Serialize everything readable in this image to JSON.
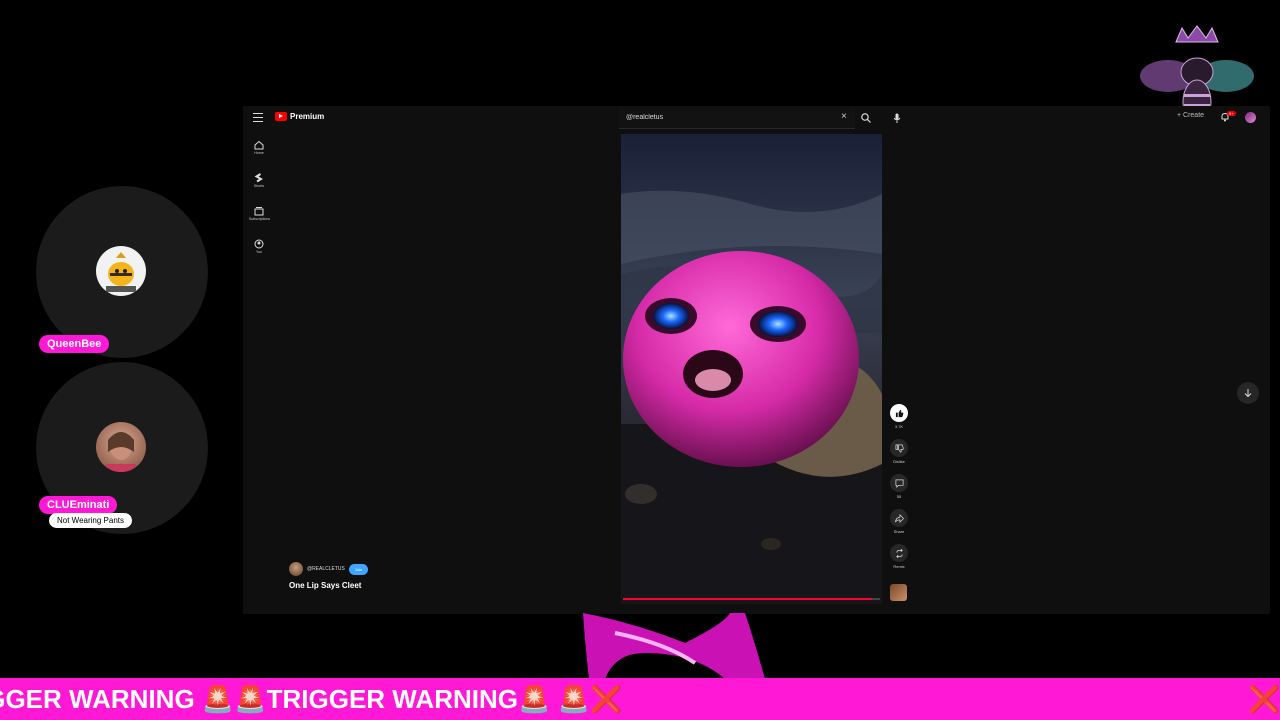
{
  "participants": [
    {
      "name": "QueenBee",
      "status": ""
    },
    {
      "name": "CLUEminati",
      "status": "Not Wearing Pants"
    }
  ],
  "youtube": {
    "brand": "Premium",
    "search": {
      "value": "@realcletus",
      "placeholder": "Search"
    },
    "create_label": "+ Create",
    "notification_count": "9+",
    "nav": [
      {
        "label": "Home",
        "icon": "home-icon"
      },
      {
        "label": "Shorts",
        "icon": "shorts-icon"
      },
      {
        "label": "Subscriptions",
        "icon": "subscriptions-icon"
      },
      {
        "label": "You",
        "icon": "you-icon"
      }
    ],
    "short": {
      "channel": "@REALCLETUS",
      "join_label": "Join",
      "title": "One Lip Says Cleet",
      "progress": 0.97,
      "actions": [
        {
          "label": "3.7K",
          "icon": "like-icon"
        },
        {
          "label": "Dislike",
          "icon": "dislike-icon"
        },
        {
          "label": "55",
          "icon": "comment-icon"
        },
        {
          "label": "Share",
          "icon": "share-icon"
        },
        {
          "label": "Remix",
          "icon": "remix-icon"
        }
      ]
    }
  },
  "ticker": {
    "text": "IGGER WARNING 🚨🚨TRIGGER WARNING🚨 🚨❌",
    "end_icon": "❌"
  },
  "colors": {
    "accent_pink": "#ff19d6",
    "yt_red": "#ff0000",
    "join_blue": "#3ea6ff"
  }
}
